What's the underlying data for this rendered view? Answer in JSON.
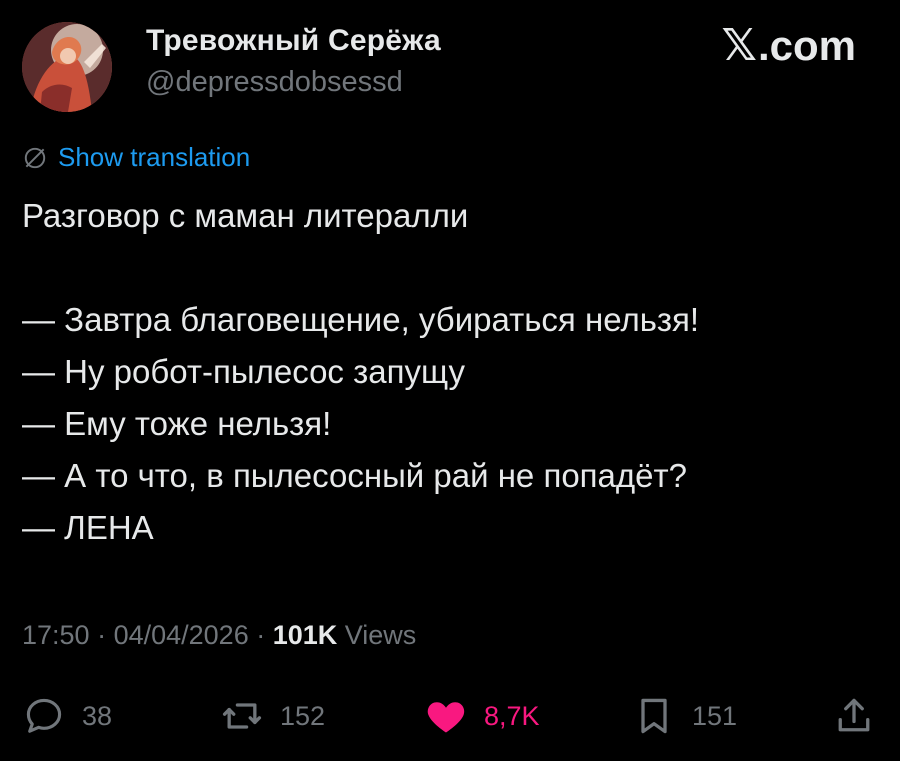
{
  "author": {
    "display_name": "Тревожный Серёжа",
    "handle": "@depressdobsessd",
    "avatar_icon": "avatar-image"
  },
  "brand": {
    "x_glyph": "𝕏",
    "label": ".com"
  },
  "translation": {
    "icon": "globe-icon",
    "label": "Show translation"
  },
  "tweet": {
    "lines": [
      "Разговор с маман литералли",
      "",
      "— Завтра благовещение, убираться нельзя!",
      "— Ну робот-пылесос запущу",
      "— Ему тоже нельзя!",
      "— А то что, в пылесосный рай не попадёт?",
      "— ЛЕНА"
    ]
  },
  "meta": {
    "time": "17:50",
    "separator": " · ",
    "date": "04/04/2026",
    "views_count": "101K",
    "views_label": " Views"
  },
  "actions": {
    "reply": {
      "icon": "reply-icon",
      "count": "38"
    },
    "repost": {
      "icon": "repost-icon",
      "count": "152"
    },
    "like": {
      "icon": "heart-icon",
      "count": "8,7K",
      "liked": true,
      "color": "#f91880"
    },
    "bookmark": {
      "icon": "bookmark-icon",
      "count": "151"
    },
    "share": {
      "icon": "share-icon"
    }
  },
  "colors": {
    "background": "#000000",
    "text": "#e7e9ea",
    "secondary": "#71767b",
    "link": "#1d9bf0",
    "like": "#f91880"
  }
}
